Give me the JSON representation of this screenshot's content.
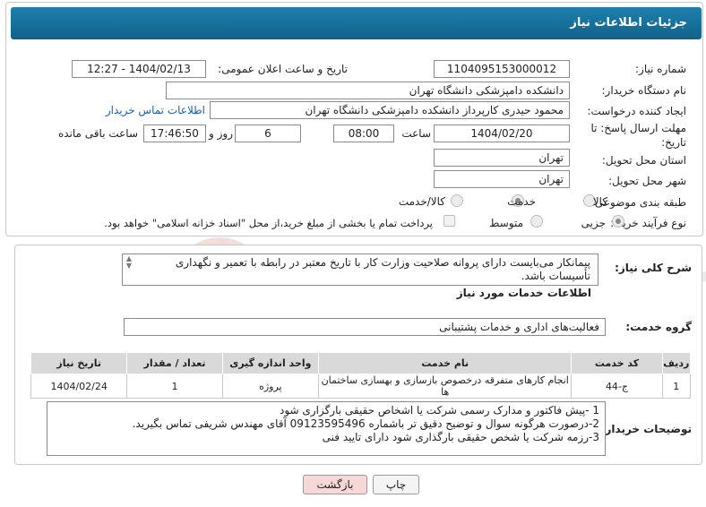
{
  "header": {
    "title": "جزئیات اطلاعات نیاز"
  },
  "fields": {
    "need_number_label": "شماره نیاز:",
    "need_number": "1104095153000012",
    "announce_label": "تاریخ و ساعت اعلان عمومی:",
    "announce_value": "1404/02/13 - 12:27",
    "buyer_org_label": "نام دستگاه خریدار:",
    "buyer_org": "دانشکده دامپزشکی دانشگاه تهران",
    "creator_label": "ایجاد کننده درخواست:",
    "creator": "محمود حیدری کارپرداز دانشکده دامپزشکی دانشگاه تهران",
    "contact_link": "اطلاعات تماس خریدار",
    "deadline_label": "مهلت ارسال پاسخ: تا تاریخ:",
    "deadline_date": "1404/02/20",
    "time_label": "ساعت",
    "deadline_time": "08:00",
    "days_value": "6",
    "days_label": "روز و",
    "remaining_time": "17:46:50",
    "remaining_label": "ساعت باقی مانده",
    "province_label": "استان محل تحویل:",
    "province": "تهران",
    "city_label": "شهر محل تحویل:",
    "city": "تهران",
    "category_label": "طبقه بندی موضوعی:",
    "category_options": [
      "کالا",
      "خدمت",
      "کالا/خدمت"
    ],
    "category_selected": "خدمت",
    "process_label": "نوع فرآیند خرید :",
    "process_options": [
      "جزیی",
      "متوسط"
    ],
    "process_selected": "جزیی",
    "payment_note": "پرداخت تمام یا بخشی از مبلغ خرید،از محل \"اسناد خزانه اسلامی\" خواهد بود."
  },
  "summary": {
    "label": "شرح کلی نیاز:",
    "text": "پیمانکار می‌بایست دارای پروانه صلاحیت وزارت کار با تاریخ معتبر در رابطه با تعمیر و نگهداری تأسیسات باشد."
  },
  "services": {
    "section_title": "اطلاعات خدمات مورد نیاز",
    "group_label": "گروه خدمت:",
    "group_value": "فعالیت‌های اداری و خدمات پشتیبانی",
    "columns": [
      "ردیف",
      "کد خدمت",
      "نام خدمت",
      "واحد اندازه گیری",
      "تعداد / مقدار",
      "تاریخ نیاز"
    ],
    "rows": [
      [
        "1",
        "ج-44",
        "انجام کارهای متفرقه درخصوص بازسازی و بهسازی ساختمان ها",
        "پروژه",
        "1",
        "1404/02/24"
      ]
    ]
  },
  "buyer_notes": {
    "label": "توضیحات خریدار:",
    "lines": [
      "1 -پیش فاکتور و مدارک رسمی شرکت  یا اشخاص حقیقی بارگزاری  شود",
      "2-درصورت هرگونه سوال و توضیح دقیق تر باشماره 09123595496 آقای مهندس شریفی تماس بگیرید.",
      "3-رزمه شرکت یا شخص حقیقی بارگذاری شود دارای تایید فنی"
    ]
  },
  "buttons": {
    "print": "چاپ",
    "back": "بازگشت"
  },
  "watermark": "AriaTender.neT",
  "colors": {
    "header": "#1a73a0",
    "back_button": "#f7d7d7",
    "link": "#1a5fb4"
  }
}
